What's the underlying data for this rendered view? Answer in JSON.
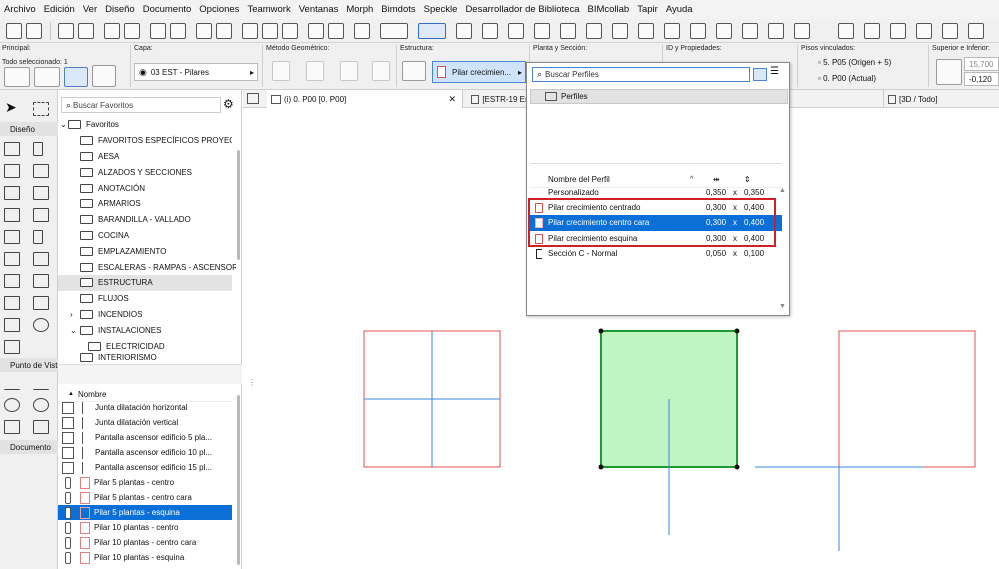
{
  "menu": [
    "Archivo",
    "Edición",
    "Ver",
    "Diseño",
    "Documento",
    "Opciones",
    "Teamwork",
    "Ventanas",
    "Morph",
    "Bimdots",
    "Speckle",
    "Desarrollador de Biblioteca",
    "BIMcollab",
    "Tapir",
    "Ayuda"
  ],
  "infobox": {
    "principal_label": "Principal:",
    "selection_text": "Todo seleccionado: 1",
    "capa_label": "Capa:",
    "capa_value": "03 EST - Pilares",
    "metodo_label": "Método Geométrico:",
    "estructura_label": "Estructura:",
    "estructura_value": "Pilar crecimien...",
    "planta_label": "Planta y Sección:",
    "id_label": "ID y Propiedades:",
    "pisos_label": "Pisos vinculados:",
    "piso_top": "5. P05 (Origen + 5)",
    "piso_bottom": "0. P00 (Actual)",
    "superior_label": "Superior e Inferior:",
    "superior_value": "15,700",
    "inferior_value": "-0,120"
  },
  "palette": {
    "diseno": "Diseño",
    "punto_vista": "Punto de Vista",
    "documento": "Documento"
  },
  "favorites": {
    "search_placeholder": "Buscar Favoritos",
    "root": "Favoritos",
    "folders": [
      "FAVORITOS ESPECÍFICOS PROYECTO",
      "AESA",
      "ALZADOS Y SECCIONES",
      "ANOTACIÓN",
      "ARMARIOS",
      "BARANDILLA - VALLADO",
      "COCINA",
      "EMPLAZAMIENTO",
      "ESCALERAS - RAMPAS - ASCENSORES",
      "ESTRUCTURA",
      "FLUJOS",
      "INCENDIOS",
      "INSTALACIONES",
      "ELECTRICIDAD",
      "INTERIORISMO"
    ],
    "list_header": "Nombre",
    "items": [
      "Junta dilatación horizontal",
      "Junta dilatación vertical",
      "Pantalla ascensor edificio 5 pla...",
      "Pantalla ascensor edificio 10 pl...",
      "Pantalla ascensor edificio 15 pl...",
      "Pilar 5 plantas - centro",
      "Pilar 5 plantas - centro cara",
      "Pilar 5 plantas - esquina",
      "Pilar 10 plantas - centro",
      "Pilar 10 plantas - centro cara",
      "Pilar 10 plantas - esquina"
    ]
  },
  "tabs": {
    "plan": "(i) 0. P00 [0. P00]",
    "estr": "[ESTR-19 Es",
    "view3d": "[3D / Todo]"
  },
  "profiles": {
    "search_placeholder": "Buscar Perfiles",
    "folder": "Perfiles",
    "col_name": "Nombre del Perfil",
    "rows": [
      {
        "name": "Personalizado",
        "w": "0,350",
        "x": "x",
        "h": "0,350"
      },
      {
        "name": "Pilar crecimiento centrado",
        "w": "0,300",
        "x": "x",
        "h": "0,400"
      },
      {
        "name": "Pilar crecimiento centro cara",
        "w": "0,300",
        "x": "x",
        "h": "0,400"
      },
      {
        "name": "Pilar crecimiento esquina",
        "w": "0,300",
        "x": "x",
        "h": "0,400"
      },
      {
        "name": "Sección C - Normal",
        "w": "0,050",
        "x": "x",
        "h": "0,100"
      }
    ]
  },
  "colors": {
    "selected": "#0a6fd6",
    "highlight_box": "#d11f2a",
    "column_fill": "#bff5c2",
    "column_edge": "#1e9b2e",
    "axis": "#3a86e0",
    "outline": "#e05050"
  }
}
